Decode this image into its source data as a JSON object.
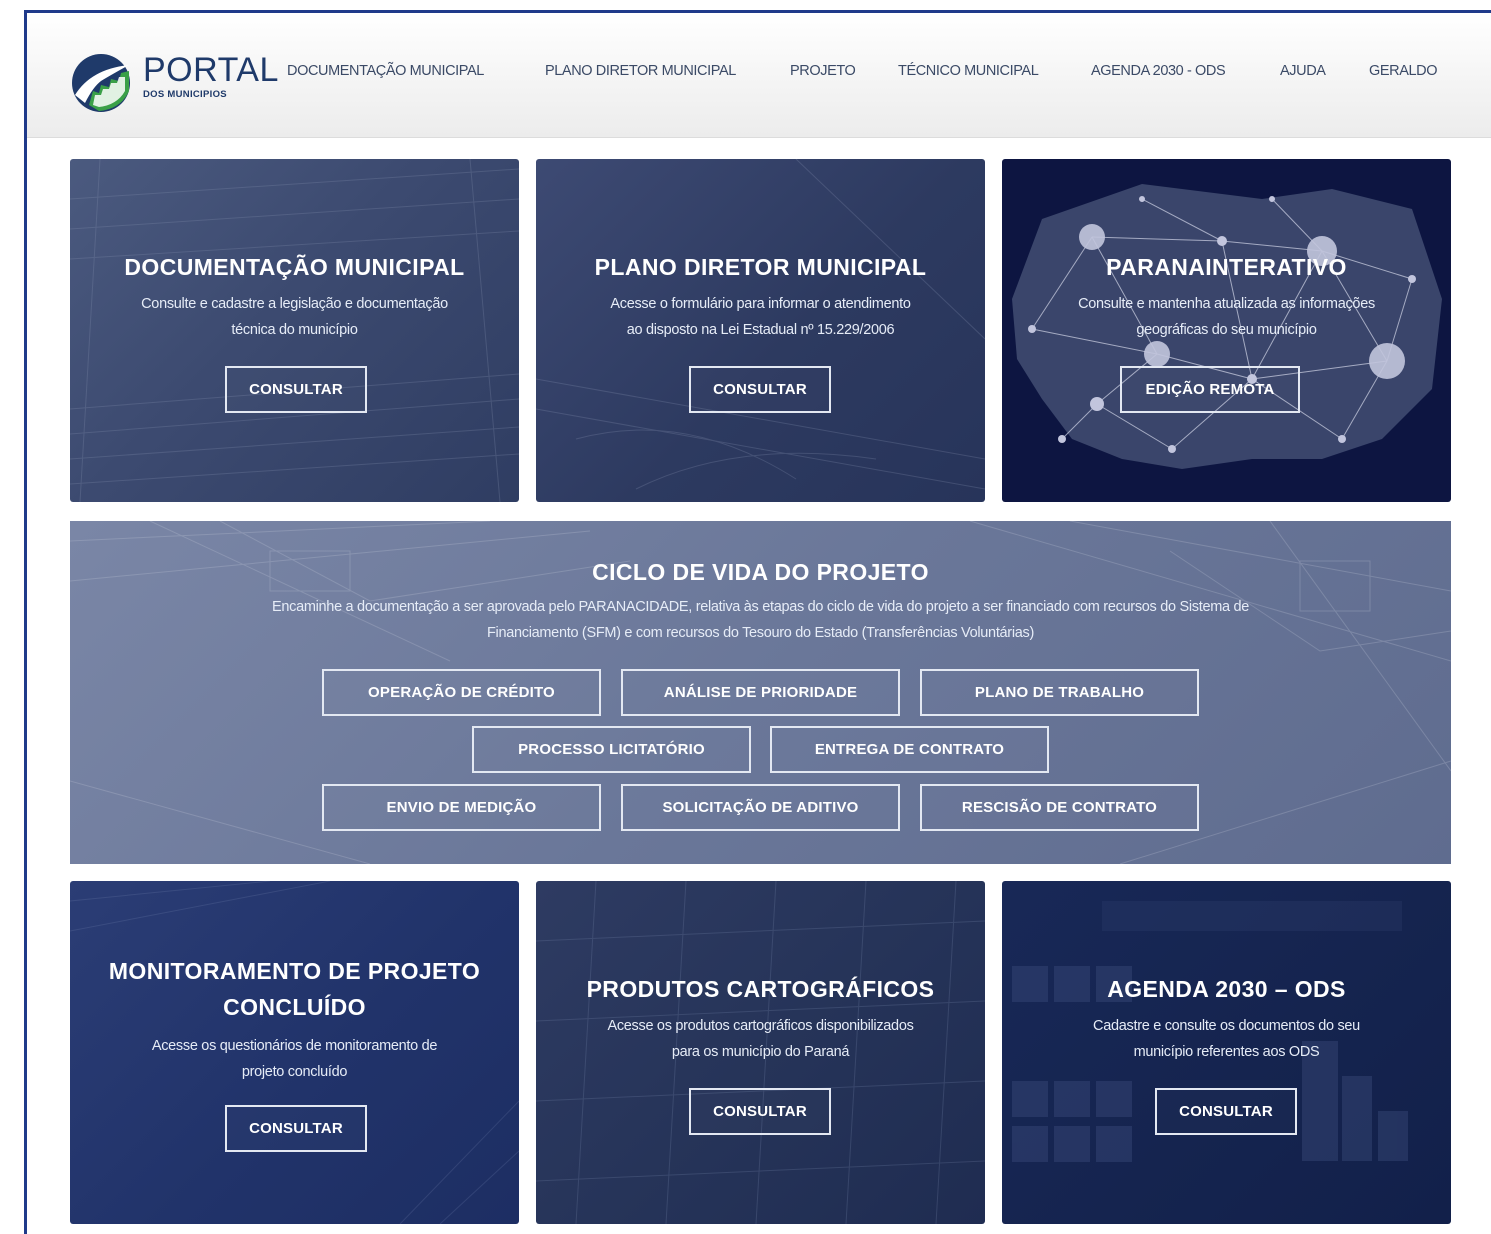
{
  "logo": {
    "title": "PORTAL",
    "subtitle": "DOS MUNICIPIOS"
  },
  "nav": [
    "DOCUMENTAÇÃO MUNICIPAL",
    "PLANO DIRETOR MUNICIPAL",
    "PROJETO",
    "TÉCNICO MUNICIPAL",
    "AGENDA 2030 - ODS",
    "AJUDA",
    "GERALDO"
  ],
  "cards": {
    "doc": {
      "title": "DOCUMENTAÇÃO MUNICIPAL",
      "desc1": "Consulte e cadastre a legislação e documentação",
      "desc2": "técnica do município",
      "button": "CONSULTAR"
    },
    "plano": {
      "title": "PLANO DIRETOR MUNICIPAL",
      "desc1": "Acesse o formulário para informar o atendimento",
      "desc2": "ao disposto na Lei Estadual nº 15.229/2006",
      "button": "CONSULTAR"
    },
    "parana": {
      "title": "PARANAINTERATIVO",
      "desc1": "Consulte e mantenha atualizada as informações",
      "desc2": "geográficas do seu município",
      "button": "EDIÇÃO REMOTA"
    },
    "ciclo": {
      "title": "CICLO DE VIDA DO PROJETO",
      "desc1": "Encaminhe a documentação a ser aprovada pelo PARANACIDADE, relativa às etapas do ciclo de vida do projeto a ser financiado com recursos do Sistema de",
      "desc2": "Financiamento (SFM) e com recursos do Tesouro do Estado (Transferências Voluntárias)",
      "buttons": [
        "OPERAÇÃO DE CRÉDITO",
        "ANÁLISE DE PRIORIDADE",
        "PLANO DE TRABALHO",
        "PROCESSO LICITATÓRIO",
        "ENTREGA DE CONTRATO",
        "ENVIO DE MEDIÇÃO",
        "SOLICITAÇÃO DE ADITIVO",
        "RESCISÃO DE CONTRATO"
      ]
    },
    "monit": {
      "title1": "MONITORAMENTO DE PROJETO",
      "title2": "CONCLUÍDO",
      "desc1": "Acesse os questionários de monitoramento de",
      "desc2": "projeto concluído",
      "button": "CONSULTAR"
    },
    "prod": {
      "title": "PRODUTOS CARTOGRÁFICOS",
      "desc1": "Acesse os produtos cartográficos disponibilizados",
      "desc2": "para os município do Paraná",
      "button": "CONSULTAR"
    },
    "agenda": {
      "title": "AGENDA 2030 – ODS",
      "desc1": "Cadastre e consulte os documentos do seu",
      "desc2": "município referentes aos ODS",
      "button": "CONSULTAR"
    }
  },
  "colors": {
    "nav_text": "#3b4a66",
    "brand_blue": "#1f3a6a",
    "brand_green": "#3aa048",
    "card_dark": "#0d1541"
  }
}
